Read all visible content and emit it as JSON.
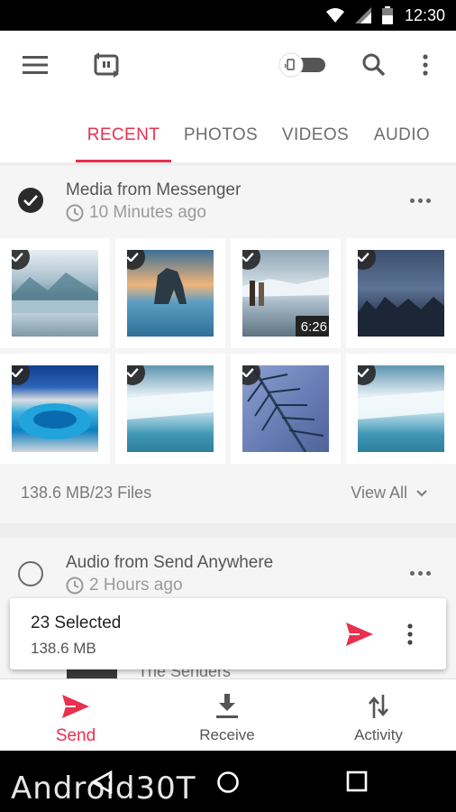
{
  "status_bar": {
    "time": "12:30"
  },
  "tabs": [
    {
      "label": "RECENT"
    },
    {
      "label": "PHOTOS"
    },
    {
      "label": "VIDEOS"
    },
    {
      "label": "AUDIO"
    }
  ],
  "messenger_card": {
    "title": "Media from Messenger",
    "time": "10 Minutes ago",
    "summary": "138.6 MB/23 Files",
    "view_all": "View All",
    "video_duration": "6:26"
  },
  "audio_card": {
    "title": "Audio from Send Anywhere",
    "time": "2 Hours ago",
    "partial_text": "The Senders"
  },
  "selection": {
    "count": "23 Selected",
    "size": "138.6 MB"
  },
  "bottom_nav": [
    {
      "label": "Send"
    },
    {
      "label": "Receive"
    },
    {
      "label": "Activity"
    }
  ],
  "watermark": "Android30T",
  "colors": {
    "accent": "#e8304f"
  }
}
